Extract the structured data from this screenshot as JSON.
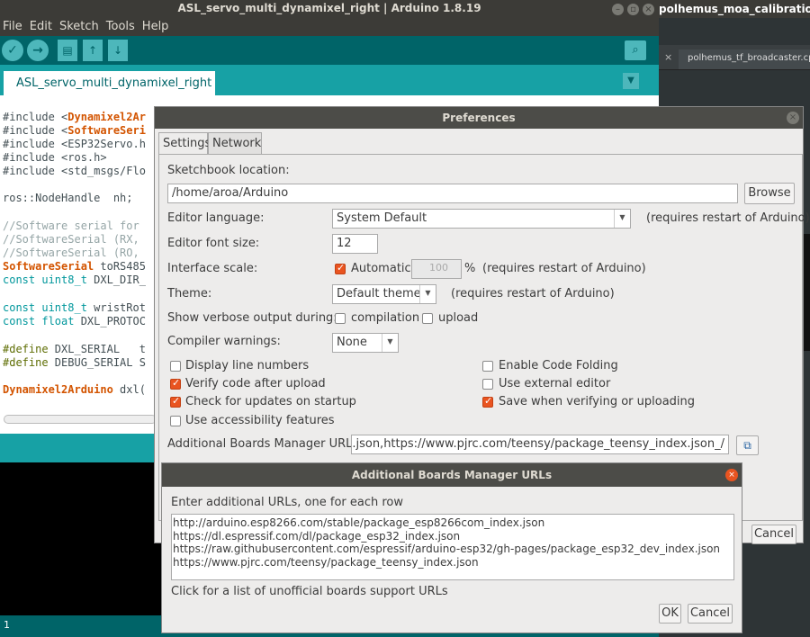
{
  "os": {
    "window_title": "ASL_servo_multi_dynamixel_right | Arduino 1.8.19",
    "window_buttons": [
      "–",
      "▫",
      "×"
    ],
    "other_window_title": "polhemus_moa_calibration.launch",
    "other_tab_label": "polhemus_tf_broadcaster.cpp",
    "other_tab_close": "×"
  },
  "ide": {
    "menu": [
      "File",
      "Edit",
      "Sketch",
      "Tools",
      "Help"
    ],
    "sketch_tab": "ASL_servo_multi_dynamixel_right",
    "footer_line": "1",
    "code_lines": {
      "l1a": "#include <",
      "l1b": "Dynamixel2Ar",
      "l2a": "#include <",
      "l2b": "SoftwareSeri",
      "l3": "#include <ESP32Servo.h",
      "l4": "#include <ros.h>",
      "l5": "#include <std_msgs/Flo",
      "l6": "ros::NodeHandle  nh;",
      "l7": "//Software serial for",
      "l8": "//SoftwareSerial (RX,",
      "l9": "//SoftwareSerial (RO,",
      "l10a": "SoftwareSerial",
      "l10b": " toRS485",
      "l11a": "const uint8_t",
      "l11b": " DXL_DIR_",
      "l12a": "const uint8_t",
      "l12b": " wristRot",
      "l13a": "const float",
      "l13b": " DXL_PROTOC",
      "l14a": "#define",
      "l14b": " DXL_SERIAL   t",
      "l15a": "#define",
      "l15b": " DEBUG_SERIAL S",
      "l16a": "Dynamixel2Arduino",
      "l16b": " dxl("
    }
  },
  "prefs": {
    "title": "Preferences",
    "close": "×",
    "tabs": [
      "Settings",
      "Network"
    ],
    "sketchbook_label": "Sketchbook location:",
    "sketchbook_path": "/home/aroa/Arduino",
    "browse": "Browse",
    "editor_language_label": "Editor language:",
    "editor_language": "System Default",
    "restart_note": "(requires restart of Arduino)",
    "font_size_label": "Editor font size:",
    "font_size": "12",
    "interface_scale_label": "Interface scale:",
    "automatic_label": "Automatic",
    "automatic_checked": true,
    "scale_value": "100",
    "percent": "%",
    "theme_label": "Theme:",
    "theme": "Default theme",
    "verbose_label": "Show verbose output during:",
    "compilation_label": "compilation",
    "upload_label": "upload",
    "warnings_label": "Compiler warnings:",
    "warnings": "None",
    "opts": {
      "display_line_numbers": "Display line numbers",
      "verify_code": "Verify code after upload",
      "check_updates": "Check for updates on startup",
      "accessibility": "Use accessibility features",
      "code_folding": "Enable Code Folding",
      "external_editor": "Use external editor",
      "save_verifying": "Save when verifying or uploading"
    },
    "boards_urls_label": "Additional Boards Manager URLs:",
    "boards_urls_value": "/_index.json,https://www.pjrc.com/teensy/package_teensy_index.json",
    "cancel": "Cancel"
  },
  "boards_dialog": {
    "title": "Additional Boards Manager URLs",
    "close": "×",
    "instruction": "Enter additional URLs, one for each row",
    "urls": [
      "http://arduino.esp8266.com/stable/package_esp8266com_index.json",
      "https://dl.espressif.com/dl/package_esp32_index.json",
      "https://raw.githubusercontent.com/espressif/arduino-esp32/gh-pages/package_esp32_dev_index.json",
      "https://www.pjrc.com/teensy/package_teensy_index.json"
    ],
    "unofficial_link": "Click for a list of unofficial boards support URLs",
    "ok": "OK",
    "cancel": "Cancel"
  },
  "colors": {
    "arduino_teal": "#17a1a5",
    "arduino_dark_teal": "#006468",
    "checkbox_accent": "#e95420"
  },
  "icons": [
    "verify-icon",
    "upload-icon",
    "new-icon",
    "open-icon",
    "save-icon",
    "serial-monitor-icon",
    "tab-menu-icon",
    "url-edit-icon"
  ]
}
